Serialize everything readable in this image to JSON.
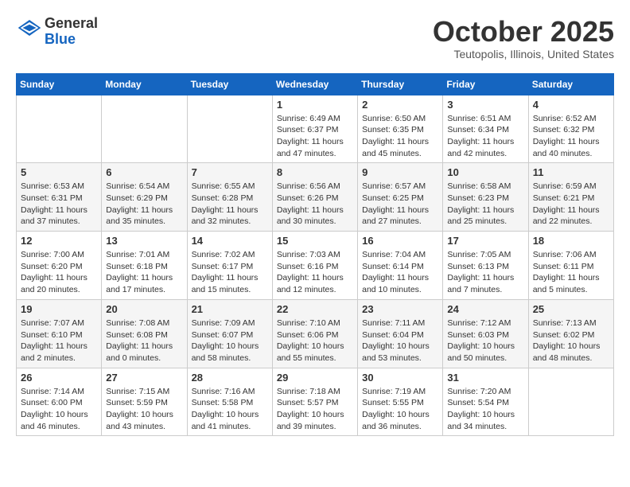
{
  "logo": {
    "line1": "General",
    "line2": "Blue"
  },
  "title": "October 2025",
  "location": "Teutopolis, Illinois, United States",
  "days_of_week": [
    "Sunday",
    "Monday",
    "Tuesday",
    "Wednesday",
    "Thursday",
    "Friday",
    "Saturday"
  ],
  "weeks": [
    [
      {
        "day": "",
        "info": ""
      },
      {
        "day": "",
        "info": ""
      },
      {
        "day": "",
        "info": ""
      },
      {
        "day": "1",
        "info": "Sunrise: 6:49 AM\nSunset: 6:37 PM\nDaylight: 11 hours\nand 47 minutes."
      },
      {
        "day": "2",
        "info": "Sunrise: 6:50 AM\nSunset: 6:35 PM\nDaylight: 11 hours\nand 45 minutes."
      },
      {
        "day": "3",
        "info": "Sunrise: 6:51 AM\nSunset: 6:34 PM\nDaylight: 11 hours\nand 42 minutes."
      },
      {
        "day": "4",
        "info": "Sunrise: 6:52 AM\nSunset: 6:32 PM\nDaylight: 11 hours\nand 40 minutes."
      }
    ],
    [
      {
        "day": "5",
        "info": "Sunrise: 6:53 AM\nSunset: 6:31 PM\nDaylight: 11 hours\nand 37 minutes."
      },
      {
        "day": "6",
        "info": "Sunrise: 6:54 AM\nSunset: 6:29 PM\nDaylight: 11 hours\nand 35 minutes."
      },
      {
        "day": "7",
        "info": "Sunrise: 6:55 AM\nSunset: 6:28 PM\nDaylight: 11 hours\nand 32 minutes."
      },
      {
        "day": "8",
        "info": "Sunrise: 6:56 AM\nSunset: 6:26 PM\nDaylight: 11 hours\nand 30 minutes."
      },
      {
        "day": "9",
        "info": "Sunrise: 6:57 AM\nSunset: 6:25 PM\nDaylight: 11 hours\nand 27 minutes."
      },
      {
        "day": "10",
        "info": "Sunrise: 6:58 AM\nSunset: 6:23 PM\nDaylight: 11 hours\nand 25 minutes."
      },
      {
        "day": "11",
        "info": "Sunrise: 6:59 AM\nSunset: 6:21 PM\nDaylight: 11 hours\nand 22 minutes."
      }
    ],
    [
      {
        "day": "12",
        "info": "Sunrise: 7:00 AM\nSunset: 6:20 PM\nDaylight: 11 hours\nand 20 minutes."
      },
      {
        "day": "13",
        "info": "Sunrise: 7:01 AM\nSunset: 6:18 PM\nDaylight: 11 hours\nand 17 minutes."
      },
      {
        "day": "14",
        "info": "Sunrise: 7:02 AM\nSunset: 6:17 PM\nDaylight: 11 hours\nand 15 minutes."
      },
      {
        "day": "15",
        "info": "Sunrise: 7:03 AM\nSunset: 6:16 PM\nDaylight: 11 hours\nand 12 minutes."
      },
      {
        "day": "16",
        "info": "Sunrise: 7:04 AM\nSunset: 6:14 PM\nDaylight: 11 hours\nand 10 minutes."
      },
      {
        "day": "17",
        "info": "Sunrise: 7:05 AM\nSunset: 6:13 PM\nDaylight: 11 hours\nand 7 minutes."
      },
      {
        "day": "18",
        "info": "Sunrise: 7:06 AM\nSunset: 6:11 PM\nDaylight: 11 hours\nand 5 minutes."
      }
    ],
    [
      {
        "day": "19",
        "info": "Sunrise: 7:07 AM\nSunset: 6:10 PM\nDaylight: 11 hours\nand 2 minutes."
      },
      {
        "day": "20",
        "info": "Sunrise: 7:08 AM\nSunset: 6:08 PM\nDaylight: 11 hours\nand 0 minutes."
      },
      {
        "day": "21",
        "info": "Sunrise: 7:09 AM\nSunset: 6:07 PM\nDaylight: 10 hours\nand 58 minutes."
      },
      {
        "day": "22",
        "info": "Sunrise: 7:10 AM\nSunset: 6:06 PM\nDaylight: 10 hours\nand 55 minutes."
      },
      {
        "day": "23",
        "info": "Sunrise: 7:11 AM\nSunset: 6:04 PM\nDaylight: 10 hours\nand 53 minutes."
      },
      {
        "day": "24",
        "info": "Sunrise: 7:12 AM\nSunset: 6:03 PM\nDaylight: 10 hours\nand 50 minutes."
      },
      {
        "day": "25",
        "info": "Sunrise: 7:13 AM\nSunset: 6:02 PM\nDaylight: 10 hours\nand 48 minutes."
      }
    ],
    [
      {
        "day": "26",
        "info": "Sunrise: 7:14 AM\nSunset: 6:00 PM\nDaylight: 10 hours\nand 46 minutes."
      },
      {
        "day": "27",
        "info": "Sunrise: 7:15 AM\nSunset: 5:59 PM\nDaylight: 10 hours\nand 43 minutes."
      },
      {
        "day": "28",
        "info": "Sunrise: 7:16 AM\nSunset: 5:58 PM\nDaylight: 10 hours\nand 41 minutes."
      },
      {
        "day": "29",
        "info": "Sunrise: 7:18 AM\nSunset: 5:57 PM\nDaylight: 10 hours\nand 39 minutes."
      },
      {
        "day": "30",
        "info": "Sunrise: 7:19 AM\nSunset: 5:55 PM\nDaylight: 10 hours\nand 36 minutes."
      },
      {
        "day": "31",
        "info": "Sunrise: 7:20 AM\nSunset: 5:54 PM\nDaylight: 10 hours\nand 34 minutes."
      },
      {
        "day": "",
        "info": ""
      }
    ]
  ]
}
